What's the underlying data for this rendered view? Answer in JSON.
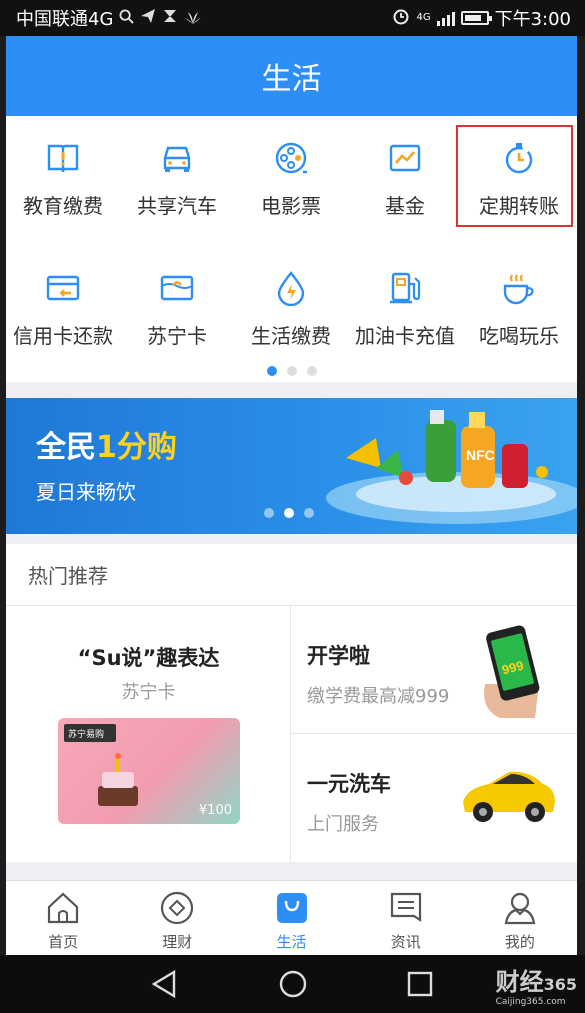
{
  "status_bar": {
    "carrier": "中国联通4G",
    "network": "4G",
    "time": "下午3:00"
  },
  "header": {
    "title": "生活"
  },
  "services": {
    "row1": [
      {
        "label": "教育缴费",
        "icon": "book-icon"
      },
      {
        "label": "共享汽车",
        "icon": "car-icon"
      },
      {
        "label": "电影票",
        "icon": "film-reel-icon"
      },
      {
        "label": "基金",
        "icon": "chart-icon"
      },
      {
        "label": "定期转账",
        "icon": "timer-icon"
      }
    ],
    "row2": [
      {
        "label": "信用卡还款",
        "icon": "credit-card-icon"
      },
      {
        "label": "苏宁卡",
        "icon": "gift-card-icon"
      },
      {
        "label": "生活缴费",
        "icon": "water-drop-icon"
      },
      {
        "label": "加油卡充值",
        "icon": "fuel-pump-icon"
      },
      {
        "label": "吃喝玩乐",
        "icon": "coffee-cup-icon"
      }
    ],
    "page_dots": 3,
    "active_dot": 0,
    "highlighted": "定期转账"
  },
  "banner": {
    "title_prefix": "全民",
    "title_highlight": "1分购",
    "subtitle": "夏日来畅饮",
    "dots": 3,
    "active_dot": 1,
    "bottle_label": "NFC"
  },
  "hot": {
    "header": "热门推荐",
    "left": {
      "title": "“Su说”趣表达",
      "subtitle": "苏宁卡",
      "card_brand": "苏宁易购",
      "card_amount": "¥100"
    },
    "right_top": {
      "title": "开学啦",
      "subtitle": "缴学费最高减999"
    },
    "right_bottom": {
      "title": "一元洗车",
      "subtitle": "上门服务"
    }
  },
  "tabbar": [
    {
      "label": "首页",
      "icon": "home-icon"
    },
    {
      "label": "理财",
      "icon": "diamond-circle-icon"
    },
    {
      "label": "生活",
      "icon": "bag-icon"
    },
    {
      "label": "资讯",
      "icon": "news-icon"
    },
    {
      "label": "我的",
      "icon": "person-icon"
    }
  ],
  "active_tab": "生活",
  "watermark": {
    "main": "财经",
    "sub": "Caijing365.com",
    "num": "365"
  },
  "colors": {
    "brand": "#2d8ef5",
    "highlight_border": "#dd3333"
  }
}
